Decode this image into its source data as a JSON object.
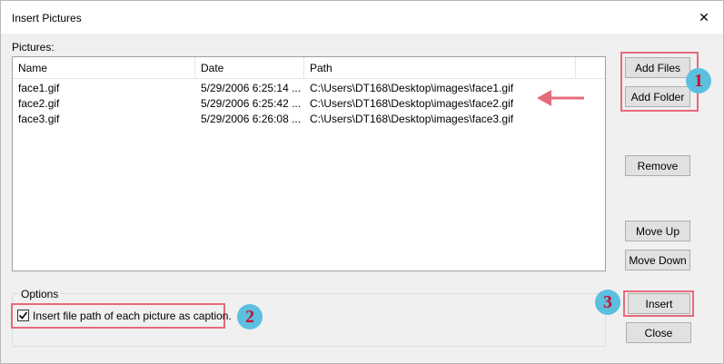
{
  "window": {
    "title": "Insert Pictures",
    "close_glyph": "✕"
  },
  "pictures": {
    "label": "Pictures:",
    "columns": [
      "Name",
      "Date",
      "Path"
    ],
    "rows": [
      {
        "name": "face1.gif",
        "date": "5/29/2006 6:25:14 ...",
        "path": "C:\\Users\\DT168\\Desktop\\images\\face1.gif"
      },
      {
        "name": "face2.gif",
        "date": "5/29/2006 6:25:42 ...",
        "path": "C:\\Users\\DT168\\Desktop\\images\\face2.gif"
      },
      {
        "name": "face3.gif",
        "date": "5/29/2006 6:26:08 ...",
        "path": "C:\\Users\\DT168\\Desktop\\images\\face3.gif"
      }
    ]
  },
  "buttons": {
    "add_files": "Add Files",
    "add_folder": "Add Folder",
    "remove": "Remove",
    "move_up": "Move Up",
    "move_down": "Move Down",
    "insert": "Insert",
    "close": "Close"
  },
  "options": {
    "legend": "Options",
    "caption_checkbox_label": "Insert file path of each picture as caption.",
    "caption_checked": true
  },
  "annotations": {
    "badge_1": "1",
    "badge_2": "2",
    "badge_3": "3",
    "highlight_color": "#e56b7a",
    "badge_color": "#5bbfe0",
    "badge_text_color": "#c8102e"
  }
}
